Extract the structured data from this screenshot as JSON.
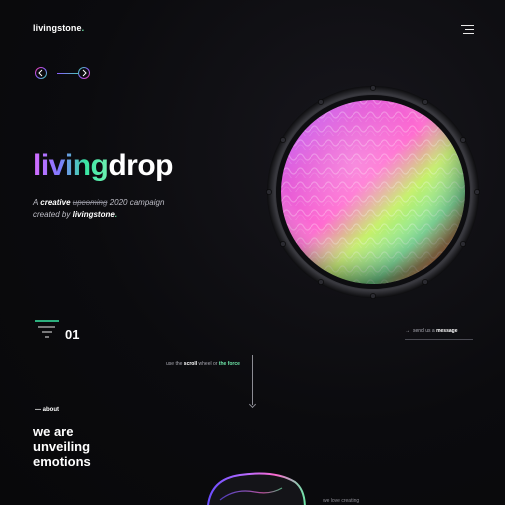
{
  "header": {
    "brand_main": "livingstone",
    "brand_dot": ".",
    "menu_icon": "hamburger-icon"
  },
  "nav": {
    "prev_icon": "arrow-left-icon",
    "next_icon": "arrow-right-icon"
  },
  "hero": {
    "title_part1": "living",
    "title_part2": "drop",
    "tagline": {
      "a": "A",
      "creative": "creative",
      "struck": "upcoming",
      "rest": "2020 campaign",
      "created_by": "created by",
      "brand_main": "livingstone",
      "brand_dot": "."
    }
  },
  "section": {
    "number": "01",
    "send_prefix": "send us a",
    "send_bold": "message",
    "send_arrow": "→"
  },
  "scroll_hint": {
    "pre": "use the",
    "scroll": "scroll",
    "mid": "wheel or",
    "force": "the force"
  },
  "about": {
    "label": "— about",
    "title_line1": "we are",
    "title_line2": "unveiling",
    "title_line3": "emotions",
    "teaser": "we love creating"
  },
  "colors": {
    "accent_green": "#6ee6a8",
    "accent_purple": "#8a5cff",
    "accent_pink": "#ff3fa4",
    "background": "#0a0a0c"
  }
}
